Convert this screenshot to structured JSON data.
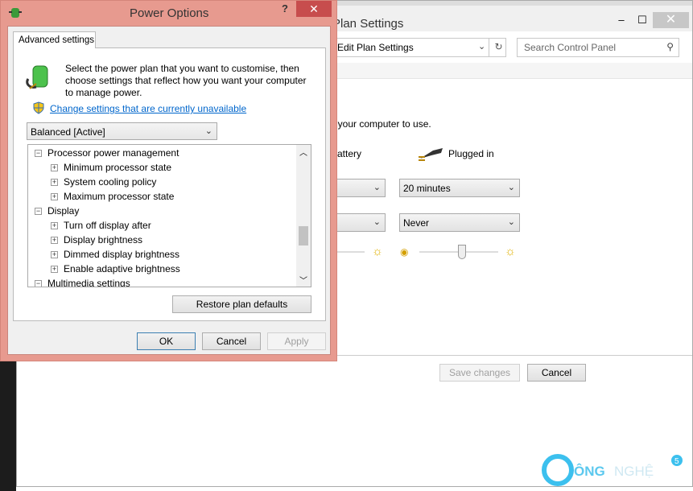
{
  "background_window": {
    "title": "Plan Settings",
    "controls": {
      "minimize": "‒",
      "maximize": "☐",
      "close": "✕"
    },
    "address": "Edit Plan Settings",
    "search_placeholder": "Search Control Panel",
    "description": "t your computer to use.",
    "battery_label": "attery",
    "plugged_in_label": "Plugged in",
    "dim_display_plugged": "20 minutes",
    "sleep_plugged": "Never",
    "brightness_plugged_percent": 55,
    "save_changes": "Save changes",
    "cancel": "Cancel"
  },
  "dialog": {
    "title": "Power Options",
    "help": "?",
    "close": "✕",
    "tab": "Advanced settings",
    "intro": [
      "Select the power plan that you want to customise, then",
      "choose settings that reflect how you want your computer",
      "to manage power."
    ],
    "link": "Change settings that are currently unavailable",
    "plan": "Balanced [Active]",
    "tree": [
      {
        "label": "Processor power management",
        "level": 0,
        "sign": "−"
      },
      {
        "label": "Minimum processor state",
        "level": 1,
        "sign": "+"
      },
      {
        "label": "System cooling policy",
        "level": 1,
        "sign": "+"
      },
      {
        "label": "Maximum processor state",
        "level": 1,
        "sign": "+"
      },
      {
        "label": "Display",
        "level": 0,
        "sign": "−"
      },
      {
        "label": "Turn off display after",
        "level": 1,
        "sign": "+"
      },
      {
        "label": "Display brightness",
        "level": 1,
        "sign": "+"
      },
      {
        "label": "Dimmed display brightness",
        "level": 1,
        "sign": "+"
      },
      {
        "label": "Enable adaptive brightness",
        "level": 1,
        "sign": "+"
      },
      {
        "label": "Multimedia settings",
        "level": 0,
        "sign": "−"
      }
    ],
    "restore": "Restore plan defaults",
    "ok": "OK",
    "cancel": "Cancel",
    "apply": "Apply"
  },
  "watermark": "CÔNGNGHỆ 5",
  "colors": {
    "dialog_frame": "#e79a8f",
    "link": "#0066cc",
    "close": "#c74d4d"
  }
}
